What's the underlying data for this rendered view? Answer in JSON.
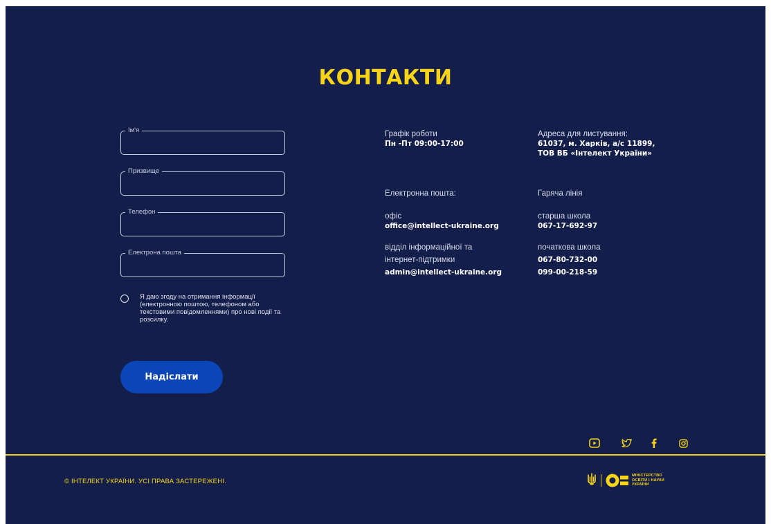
{
  "page": {
    "title": "КОНТАКТИ",
    "colors": {
      "background": "#141e4b",
      "accent": "#f7d418",
      "button": "#0b46b8"
    }
  },
  "form": {
    "fields": [
      {
        "label": "Ім'я",
        "value": ""
      },
      {
        "label": "Призвище",
        "value": ""
      },
      {
        "label": "Телефон",
        "value": ""
      },
      {
        "label": "Електрона пошта",
        "value": ""
      }
    ],
    "consent": "Я даю згоду на отримання інформації (електронною поштою, телефоном або текстовими повідомленнями) про нові події та розсилку.",
    "consent_checked": false,
    "submit_label": "Надіслати"
  },
  "contacts": {
    "schedule_label": "Графік роботи",
    "schedule_value": "Пн -Пт 09:00-17:00",
    "address_label": "Адреса для листування:",
    "address_line1": "61037, м. Харків, а/с 11899,",
    "address_line2": "ТОВ ВБ «Інтелект України»",
    "email_heading": "Електронна пошта:",
    "office_label": "офіс",
    "office_email": "office@intellect-ukraine.org",
    "support_label_1": "відділ інформаційної та",
    "support_label_2": "інтернет-підтримки",
    "support_email": "admin@intellect-ukraine.org",
    "hotline_heading": "Гаряча лінія",
    "senior_label": "старша школа",
    "senior_phone": "067-17-692-97",
    "primary_label": "початкова школа",
    "primary_phone_1": "067-80-732-00",
    "primary_phone_2": "099-00-218-59"
  },
  "social": [
    "youtube-icon",
    "twitter-icon",
    "facebook-icon",
    "instagram-icon"
  ],
  "footer": {
    "copyright": "© ІНТЕЛЕКТ УКРАЇНИ. УСІ ПРАВА ЗАСТЕРЕЖЕНІ.",
    "ministry_line1": "МІНІСТЕРСТВО",
    "ministry_line2": "ОСВІТИ І НАУКИ",
    "ministry_line3": "УКРАЇНИ"
  }
}
